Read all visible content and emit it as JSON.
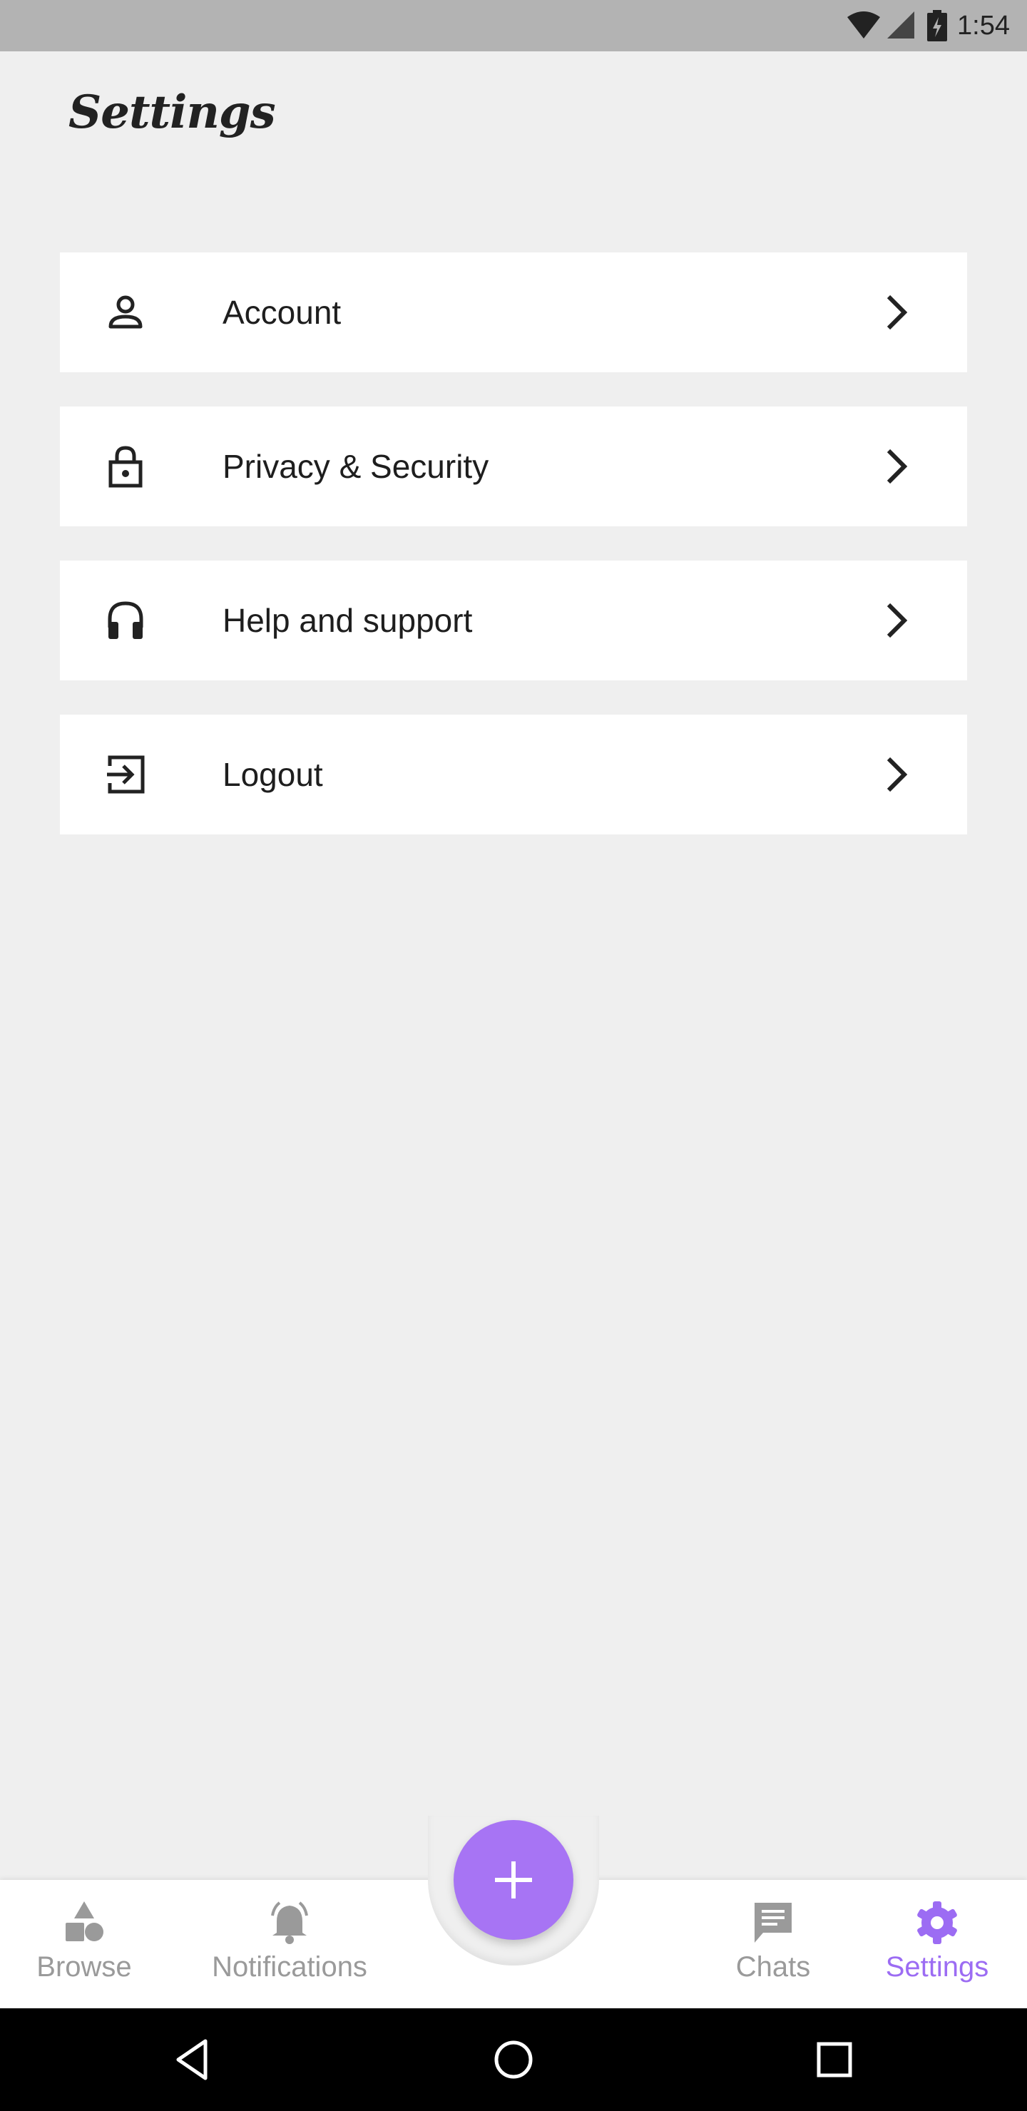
{
  "status_bar": {
    "time": "1:54",
    "icons": [
      "wifi-icon",
      "cellular-signal-icon",
      "battery-charging-icon"
    ]
  },
  "header": {
    "title": "Settings"
  },
  "settings": {
    "items": [
      {
        "label": "Account",
        "icon": "person-icon"
      },
      {
        "label": "Privacy & Security",
        "icon": "lock-icon"
      },
      {
        "label": "Help and support",
        "icon": "headphones-icon"
      },
      {
        "label": "Logout",
        "icon": "logout-icon"
      }
    ]
  },
  "bottom_nav": {
    "items": [
      {
        "label": "Browse",
        "icon": "shapes-icon",
        "active": false
      },
      {
        "label": "Notifications",
        "icon": "bell-icon",
        "active": false
      },
      {
        "label": "Chats",
        "icon": "chat-icon",
        "active": false
      },
      {
        "label": "Settings",
        "icon": "gear-icon",
        "active": true
      }
    ],
    "fab_icon": "plus-icon"
  },
  "system_nav": {
    "buttons": [
      "back-icon",
      "home-icon",
      "recents-icon"
    ]
  },
  "colors": {
    "accent": "#a774f4",
    "active_label": "#9c6cf3",
    "inactive": "#9a9a9a",
    "background": "#efefef",
    "card": "#ffffff",
    "status_bar": "#b3b3b3"
  }
}
